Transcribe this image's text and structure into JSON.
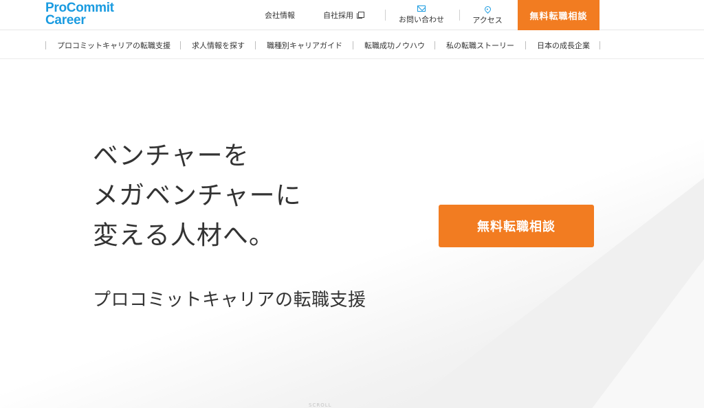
{
  "header": {
    "logo_line1": "ProCommit",
    "logo_line2": "Career",
    "company_info": "会社情報",
    "recruit": "自社採用",
    "contact": "お問い合わせ",
    "access": "アクセス",
    "cta": "無料転職相談"
  },
  "nav": {
    "items": [
      "プロコミットキャリアの転職支援",
      "求人情報を探す",
      "職種別キャリアガイド",
      "転職成功ノウハウ",
      "私の転職ストーリー",
      "日本の成長企業"
    ]
  },
  "hero": {
    "title_line1": "ベンチャーを",
    "title_line2": "メガベンチャーに",
    "title_line3": "変える人材へ。",
    "subtitle": "プロコミットキャリアの転職支援",
    "cta": "無料転職相談",
    "scroll": "SCROLL"
  },
  "colors": {
    "brand_blue": "#1a9be0",
    "accent_orange": "#f27c21"
  },
  "icons": {
    "recruit": "external-link-icon",
    "contact": "mail-icon",
    "access": "map-pin-icon"
  }
}
